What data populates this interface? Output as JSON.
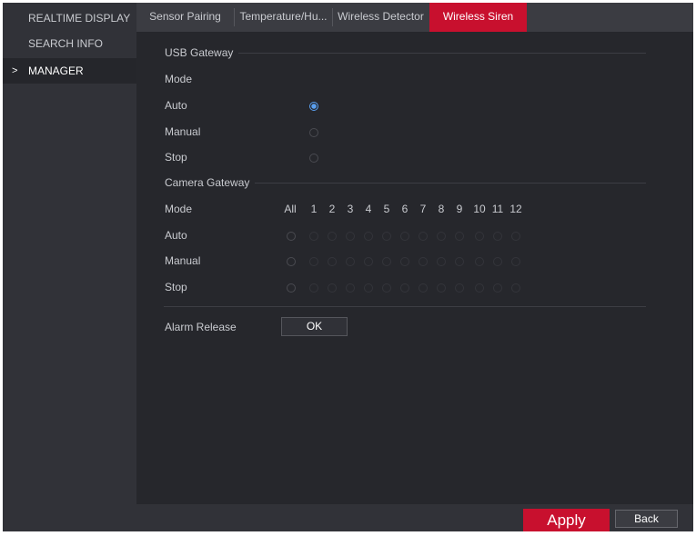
{
  "sidebar": {
    "items": [
      {
        "label": "REALTIME DISPLAY"
      },
      {
        "label": "SEARCH INFO"
      },
      {
        "label": "MANAGER"
      }
    ],
    "active_marker": ">"
  },
  "tabs": [
    {
      "label": "Sensor Pairing"
    },
    {
      "label": "Temperature/Hu..."
    },
    {
      "label": "Wireless Detector"
    },
    {
      "label": "Wireless Siren"
    }
  ],
  "usb_gateway": {
    "title": "USB Gateway",
    "mode_label": "Mode",
    "options": [
      {
        "label": "Auto",
        "checked": true
      },
      {
        "label": "Manual",
        "checked": false
      },
      {
        "label": "Stop",
        "checked": false
      }
    ]
  },
  "camera_gateway": {
    "title": "Camera Gateway",
    "mode_label": "Mode",
    "all_label": "All",
    "channels": [
      "1",
      "2",
      "3",
      "4",
      "5",
      "6",
      "7",
      "8",
      "9",
      "10",
      "11",
      "12"
    ],
    "rows": [
      {
        "label": "Auto"
      },
      {
        "label": "Manual"
      },
      {
        "label": "Stop"
      }
    ]
  },
  "alarm_release": {
    "label": "Alarm Release",
    "button": "OK"
  },
  "footer": {
    "apply": "Apply",
    "back": "Back"
  },
  "colors": {
    "accent": "#c8102e",
    "radio_selected": "#5aa0f0",
    "background": "#26272c",
    "sidebar": "#313238"
  }
}
